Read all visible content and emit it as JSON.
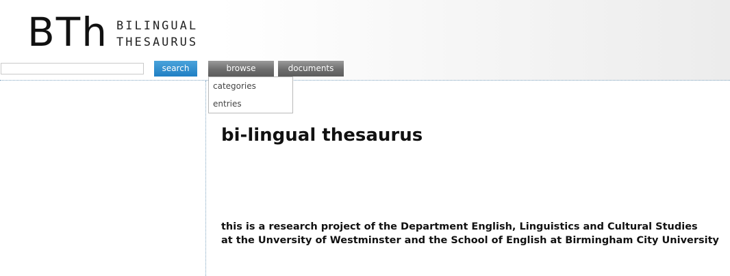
{
  "header": {
    "logo_mark": "BTh",
    "logo_line1": "BILINGUAL",
    "logo_line2": "THESAURUS"
  },
  "search": {
    "value": "",
    "placeholder": "",
    "button_label": "search"
  },
  "nav": {
    "browse_label": "browse",
    "documents_label": "documents",
    "browse_menu": [
      {
        "label": "categories"
      },
      {
        "label": "entries"
      }
    ]
  },
  "main": {
    "title": "bi-lingual thesaurus",
    "description_line1": "this is a research project of the Department English, Linguistics and Cultural Studies",
    "description_line2": "at the Unversity of Westminster and the School of English at Birmingham City University"
  },
  "colors": {
    "search_button": "#2a8bcf",
    "nav_button": "#6e6e6e",
    "divider": "#7ba2bf"
  }
}
